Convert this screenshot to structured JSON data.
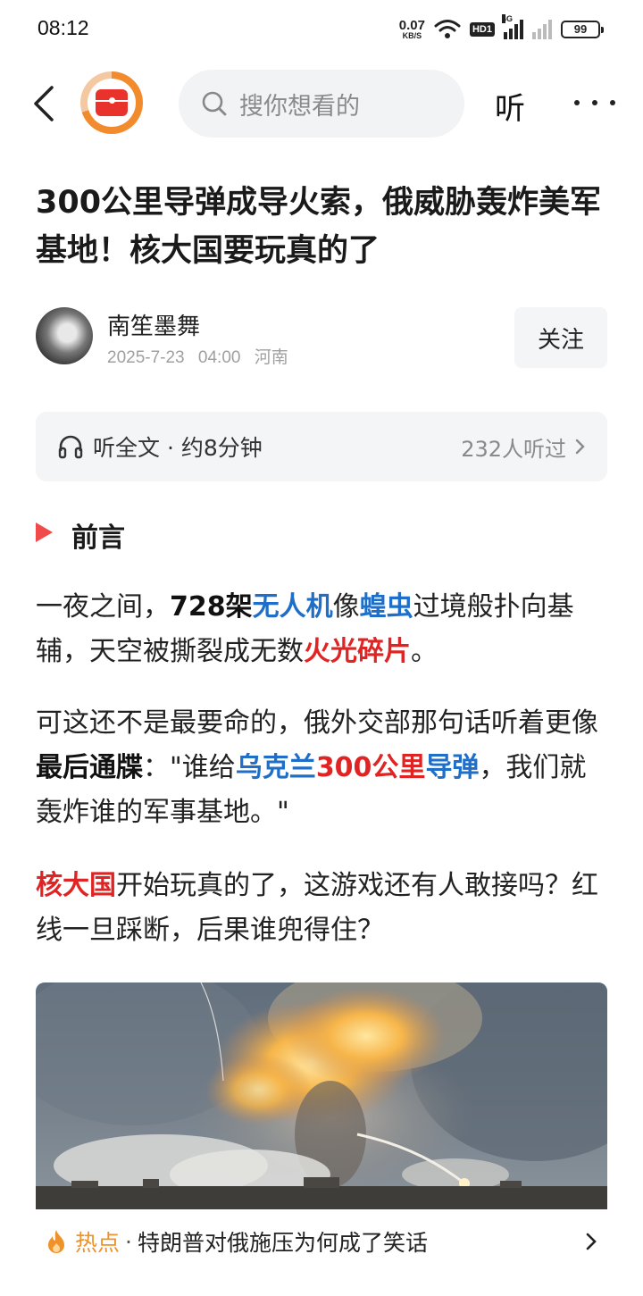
{
  "status_bar": {
    "time": "08:12",
    "net_speed": "0.07",
    "net_unit": "KB/S",
    "hd_label": "HD1",
    "network_label": "4G",
    "battery": "99"
  },
  "nav": {
    "search_placeholder": "搜你想看的",
    "listen_label": "听"
  },
  "article": {
    "title": "300公里导弹成导火索，俄威胁轰炸美军基地！核大国要玩真的了",
    "author": "南笙墨舞",
    "date": "2025-7-23",
    "time": "04:00",
    "location": "河南",
    "follow_label": "关注"
  },
  "listen_bar": {
    "label": "听全文 · 约8分钟",
    "count": "232人听过"
  },
  "section": {
    "title": "前言"
  },
  "paragraphs": {
    "p1": {
      "s1": "一夜之间，",
      "s2": "728架",
      "s3": "无人机",
      "s4": "像",
      "s5": "蝗虫",
      "s6": "过境般扑向基辅，天空被撕裂成无数",
      "s7": "火光碎片",
      "s8": "。"
    },
    "p2": {
      "s1": "可这还不是最要命的，俄外交部那句话听着更像",
      "s2": "最后通牒",
      "s3": "：\"谁给",
      "s4": "乌克兰",
      "s5": "300公里",
      "s6": "导弹",
      "s7": "，我们就轰炸谁的军事基地。\""
    },
    "p3": {
      "s1": "核大国",
      "s2": "开始玩真的了，这游戏还有人敢接吗？红线一旦踩断，后果谁兜得住？"
    }
  },
  "hot_bar": {
    "tag": "热点",
    "separator": "·",
    "text": "特朗普对俄施压为何成了笑话"
  },
  "colors": {
    "accent_red": "#e02424",
    "accent_blue": "#1f6fc9",
    "hot_orange": "#f0922a",
    "section_marker": "#f04a4a"
  }
}
